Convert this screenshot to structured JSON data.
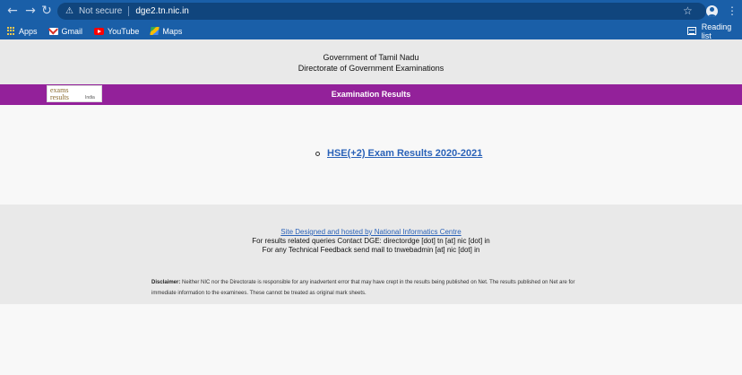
{
  "browser": {
    "back_icon": "←",
    "forward_icon": "→",
    "reload_icon": "↻",
    "security_label": "Not secure",
    "url": "dge2.tn.nic.in",
    "bookmarks": [
      {
        "label": "Apps",
        "icon": "apps-grid-icon"
      },
      {
        "label": "Gmail",
        "icon": "gmail-icon"
      },
      {
        "label": "YouTube",
        "icon": "youtube-icon"
      },
      {
        "label": "Maps",
        "icon": "maps-icon"
      }
    ],
    "reading_list": "Reading list"
  },
  "header": {
    "line1": "Government of Tamil Nadu",
    "line2": "Directorate of Government Examinations"
  },
  "banner": {
    "title": "Examination Results",
    "logo": {
      "exams": "exams",
      "results": "results",
      "india": "India"
    },
    "color": "#93219a"
  },
  "results": {
    "items": [
      {
        "label": "HSE(+2) Exam Results 2020-2021"
      }
    ]
  },
  "footer": {
    "nic_link": "Site Designed and hosted by National Informatics Centre",
    "contact_line1": "For results related queries Contact DGE:  directordge [dot] tn [at] nic [dot] in",
    "contact_line2": "For any Technical Feedback send mail to tnwebadmin [at] nic [dot] in",
    "disclaimer_label": "Disclaimer:",
    "disclaimer_text": " Neither NIC nor the Directorate is responsible for any inadvertent error that may have crept in the results being published on Net. The results published on Net are for immediate information to the examinees. These cannot be treated as original mark sheets."
  },
  "colors": {
    "chrome": "#1a5fa8",
    "link": "#2a62b8"
  }
}
